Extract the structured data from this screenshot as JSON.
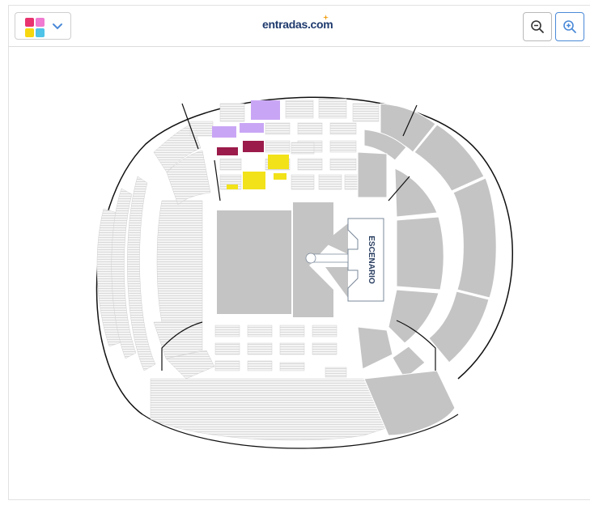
{
  "header": {
    "brand": "entradas.com",
    "brand_mark": "star-icon",
    "legend_button": {
      "icon": "color-legend-icon",
      "chevron": "chevron-down-icon"
    },
    "zoom_out": {
      "icon": "zoom-out-icon"
    },
    "zoom_in": {
      "icon": "zoom-in-icon"
    }
  },
  "legend_colors": [
    "#e8336f",
    "#f07bd0",
    "#f6d60f",
    "#4fc3e8"
  ],
  "map": {
    "stage_label": "ESCENARIO",
    "colors": {
      "available_purple": "#c9a6f5",
      "available_crimson": "#9b1b4a",
      "available_yellow": "#f2e21a",
      "unavailable_grey": "#c4c4c4",
      "accent_blue": "#4b8ad8"
    }
  }
}
